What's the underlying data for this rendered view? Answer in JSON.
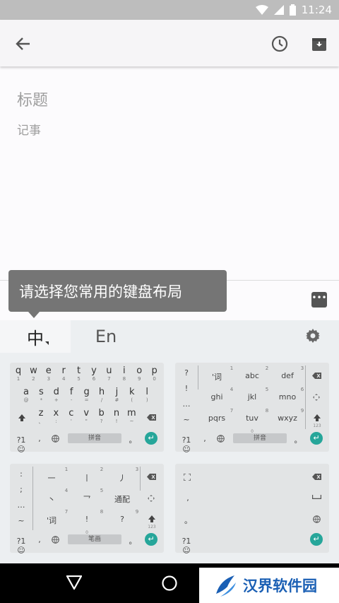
{
  "status": {
    "time": "11:24"
  },
  "toolbar": {
    "back_icon": "arrow-back-icon",
    "reminder_icon": "clock-icon",
    "archive_icon": "archive-icon"
  },
  "note": {
    "title_placeholder": "标题",
    "body_placeholder": "记事"
  },
  "tooltip": {
    "text": "请选择您常用的键盘布局"
  },
  "ime": {
    "tab_chinese": "中",
    "tab_english": "En"
  },
  "layouts": {
    "qwerty": {
      "row1": [
        [
          "q",
          "1"
        ],
        [
          "w",
          "2"
        ],
        [
          "e",
          "3"
        ],
        [
          "r",
          "4"
        ],
        [
          "t",
          "5"
        ],
        [
          "y",
          "6"
        ],
        [
          "u",
          "7"
        ],
        [
          "i",
          "8"
        ],
        [
          "o",
          "9"
        ],
        [
          "p",
          "0"
        ]
      ],
      "row2": [
        [
          "a",
          "@"
        ],
        [
          "s",
          "*"
        ],
        [
          "d",
          "+"
        ],
        [
          "f",
          "-"
        ],
        [
          "g",
          "="
        ],
        [
          "h",
          "/"
        ],
        [
          "j",
          "#"
        ],
        [
          "k",
          "("
        ],
        [
          "l",
          ")"
        ]
      ],
      "row3": [
        [
          "z",
          "、"
        ],
        [
          "x",
          ":"
        ],
        [
          "c",
          "'"
        ],
        [
          "v",
          "\""
        ],
        [
          "b",
          "?"
        ],
        [
          "n",
          "!"
        ],
        [
          "m",
          "~"
        ]
      ],
      "sym": "?1☺",
      "comma": ",",
      "space": "拼音",
      "period": "。"
    },
    "t9": {
      "left": [
        "?",
        "!",
        "…",
        "~"
      ],
      "keys": [
        [
          "'词",
          "1"
        ],
        [
          "abc",
          "2"
        ],
        [
          "def",
          "3"
        ],
        [
          "ghi",
          "4"
        ],
        [
          "jkl",
          "5"
        ],
        [
          "mno",
          "6"
        ],
        [
          "pqrs",
          "7"
        ],
        [
          "tuv",
          "8"
        ],
        [
          "wxyz",
          "9"
        ]
      ],
      "sym": "?1☺",
      "comma": ",",
      "space": "拼音",
      "period": "。",
      "zero": "0",
      "lock_label": "123"
    },
    "stroke": {
      "left": [
        ":",
        ";",
        "…",
        "~"
      ],
      "keys": [
        [
          "一",
          "1"
        ],
        [
          "丨",
          "2"
        ],
        [
          "丿",
          "3"
        ],
        [
          "丶",
          "4"
        ],
        [
          "乛",
          "5"
        ],
        [
          "通配",
          ""
        ],
        [
          "'词",
          "7"
        ],
        [
          "!",
          "8"
        ],
        [
          "?",
          "9"
        ]
      ],
      "sym": "?1☺",
      "comma": ",",
      "space": "笔画",
      "period": "。",
      "zero": "0",
      "lock_label": "123"
    },
    "handwriting": {
      "sym": "?1☺",
      "comma": ",",
      "period": "。"
    }
  },
  "watermark": {
    "text": "汉界软件园"
  },
  "colors": {
    "accent": "#26a69a",
    "tooltip": "#757575"
  }
}
